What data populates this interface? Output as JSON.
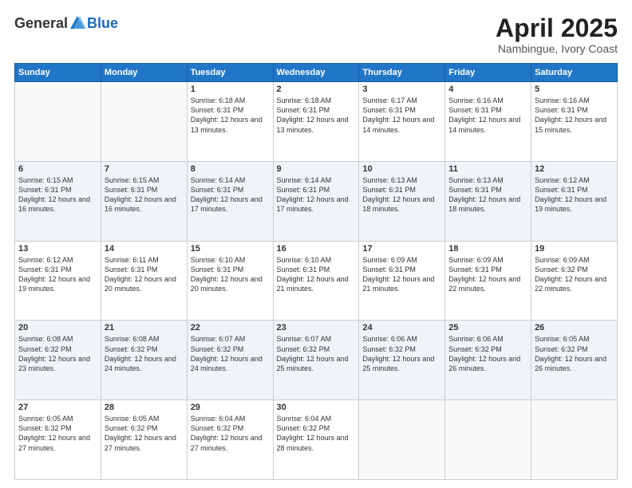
{
  "header": {
    "logo_general": "General",
    "logo_blue": "Blue",
    "month_title": "April 2025",
    "location": "Nambingue, Ivory Coast"
  },
  "days_of_week": [
    "Sunday",
    "Monday",
    "Tuesday",
    "Wednesday",
    "Thursday",
    "Friday",
    "Saturday"
  ],
  "weeks": [
    [
      {
        "day": "",
        "sunrise": "",
        "sunset": "",
        "daylight": "",
        "empty": true
      },
      {
        "day": "",
        "sunrise": "",
        "sunset": "",
        "daylight": "",
        "empty": true
      },
      {
        "day": "1",
        "sunrise": "Sunrise: 6:18 AM",
        "sunset": "Sunset: 6:31 PM",
        "daylight": "Daylight: 12 hours and 13 minutes."
      },
      {
        "day": "2",
        "sunrise": "Sunrise: 6:18 AM",
        "sunset": "Sunset: 6:31 PM",
        "daylight": "Daylight: 12 hours and 13 minutes."
      },
      {
        "day": "3",
        "sunrise": "Sunrise: 6:17 AM",
        "sunset": "Sunset: 6:31 PM",
        "daylight": "Daylight: 12 hours and 14 minutes."
      },
      {
        "day": "4",
        "sunrise": "Sunrise: 6:16 AM",
        "sunset": "Sunset: 6:31 PM",
        "daylight": "Daylight: 12 hours and 14 minutes."
      },
      {
        "day": "5",
        "sunrise": "Sunrise: 6:16 AM",
        "sunset": "Sunset: 6:31 PM",
        "daylight": "Daylight: 12 hours and 15 minutes."
      }
    ],
    [
      {
        "day": "6",
        "sunrise": "Sunrise: 6:15 AM",
        "sunset": "Sunset: 6:31 PM",
        "daylight": "Daylight: 12 hours and 16 minutes."
      },
      {
        "day": "7",
        "sunrise": "Sunrise: 6:15 AM",
        "sunset": "Sunset: 6:31 PM",
        "daylight": "Daylight: 12 hours and 16 minutes."
      },
      {
        "day": "8",
        "sunrise": "Sunrise: 6:14 AM",
        "sunset": "Sunset: 6:31 PM",
        "daylight": "Daylight: 12 hours and 17 minutes."
      },
      {
        "day": "9",
        "sunrise": "Sunrise: 6:14 AM",
        "sunset": "Sunset: 6:31 PM",
        "daylight": "Daylight: 12 hours and 17 minutes."
      },
      {
        "day": "10",
        "sunrise": "Sunrise: 6:13 AM",
        "sunset": "Sunset: 6:31 PM",
        "daylight": "Daylight: 12 hours and 18 minutes."
      },
      {
        "day": "11",
        "sunrise": "Sunrise: 6:13 AM",
        "sunset": "Sunset: 6:31 PM",
        "daylight": "Daylight: 12 hours and 18 minutes."
      },
      {
        "day": "12",
        "sunrise": "Sunrise: 6:12 AM",
        "sunset": "Sunset: 6:31 PM",
        "daylight": "Daylight: 12 hours and 19 minutes."
      }
    ],
    [
      {
        "day": "13",
        "sunrise": "Sunrise: 6:12 AM",
        "sunset": "Sunset: 6:31 PM",
        "daylight": "Daylight: 12 hours and 19 minutes."
      },
      {
        "day": "14",
        "sunrise": "Sunrise: 6:11 AM",
        "sunset": "Sunset: 6:31 PM",
        "daylight": "Daylight: 12 hours and 20 minutes."
      },
      {
        "day": "15",
        "sunrise": "Sunrise: 6:10 AM",
        "sunset": "Sunset: 6:31 PM",
        "daylight": "Daylight: 12 hours and 20 minutes."
      },
      {
        "day": "16",
        "sunrise": "Sunrise: 6:10 AM",
        "sunset": "Sunset: 6:31 PM",
        "daylight": "Daylight: 12 hours and 21 minutes."
      },
      {
        "day": "17",
        "sunrise": "Sunrise: 6:09 AM",
        "sunset": "Sunset: 6:31 PM",
        "daylight": "Daylight: 12 hours and 21 minutes."
      },
      {
        "day": "18",
        "sunrise": "Sunrise: 6:09 AM",
        "sunset": "Sunset: 6:31 PM",
        "daylight": "Daylight: 12 hours and 22 minutes."
      },
      {
        "day": "19",
        "sunrise": "Sunrise: 6:09 AM",
        "sunset": "Sunset: 6:32 PM",
        "daylight": "Daylight: 12 hours and 22 minutes."
      }
    ],
    [
      {
        "day": "20",
        "sunrise": "Sunrise: 6:08 AM",
        "sunset": "Sunset: 6:32 PM",
        "daylight": "Daylight: 12 hours and 23 minutes."
      },
      {
        "day": "21",
        "sunrise": "Sunrise: 6:08 AM",
        "sunset": "Sunset: 6:32 PM",
        "daylight": "Daylight: 12 hours and 24 minutes."
      },
      {
        "day": "22",
        "sunrise": "Sunrise: 6:07 AM",
        "sunset": "Sunset: 6:32 PM",
        "daylight": "Daylight: 12 hours and 24 minutes."
      },
      {
        "day": "23",
        "sunrise": "Sunrise: 6:07 AM",
        "sunset": "Sunset: 6:32 PM",
        "daylight": "Daylight: 12 hours and 25 minutes."
      },
      {
        "day": "24",
        "sunrise": "Sunrise: 6:06 AM",
        "sunset": "Sunset: 6:32 PM",
        "daylight": "Daylight: 12 hours and 25 minutes."
      },
      {
        "day": "25",
        "sunrise": "Sunrise: 6:06 AM",
        "sunset": "Sunset: 6:32 PM",
        "daylight": "Daylight: 12 hours and 26 minutes."
      },
      {
        "day": "26",
        "sunrise": "Sunrise: 6:05 AM",
        "sunset": "Sunset: 6:32 PM",
        "daylight": "Daylight: 12 hours and 26 minutes."
      }
    ],
    [
      {
        "day": "27",
        "sunrise": "Sunrise: 6:05 AM",
        "sunset": "Sunset: 6:32 PM",
        "daylight": "Daylight: 12 hours and 27 minutes."
      },
      {
        "day": "28",
        "sunrise": "Sunrise: 6:05 AM",
        "sunset": "Sunset: 6:32 PM",
        "daylight": "Daylight: 12 hours and 27 minutes."
      },
      {
        "day": "29",
        "sunrise": "Sunrise: 6:04 AM",
        "sunset": "Sunset: 6:32 PM",
        "daylight": "Daylight: 12 hours and 27 minutes."
      },
      {
        "day": "30",
        "sunrise": "Sunrise: 6:04 AM",
        "sunset": "Sunset: 6:32 PM",
        "daylight": "Daylight: 12 hours and 28 minutes."
      },
      {
        "day": "",
        "sunrise": "",
        "sunset": "",
        "daylight": "",
        "empty": true
      },
      {
        "day": "",
        "sunrise": "",
        "sunset": "",
        "daylight": "",
        "empty": true
      },
      {
        "day": "",
        "sunrise": "",
        "sunset": "",
        "daylight": "",
        "empty": true
      }
    ]
  ]
}
